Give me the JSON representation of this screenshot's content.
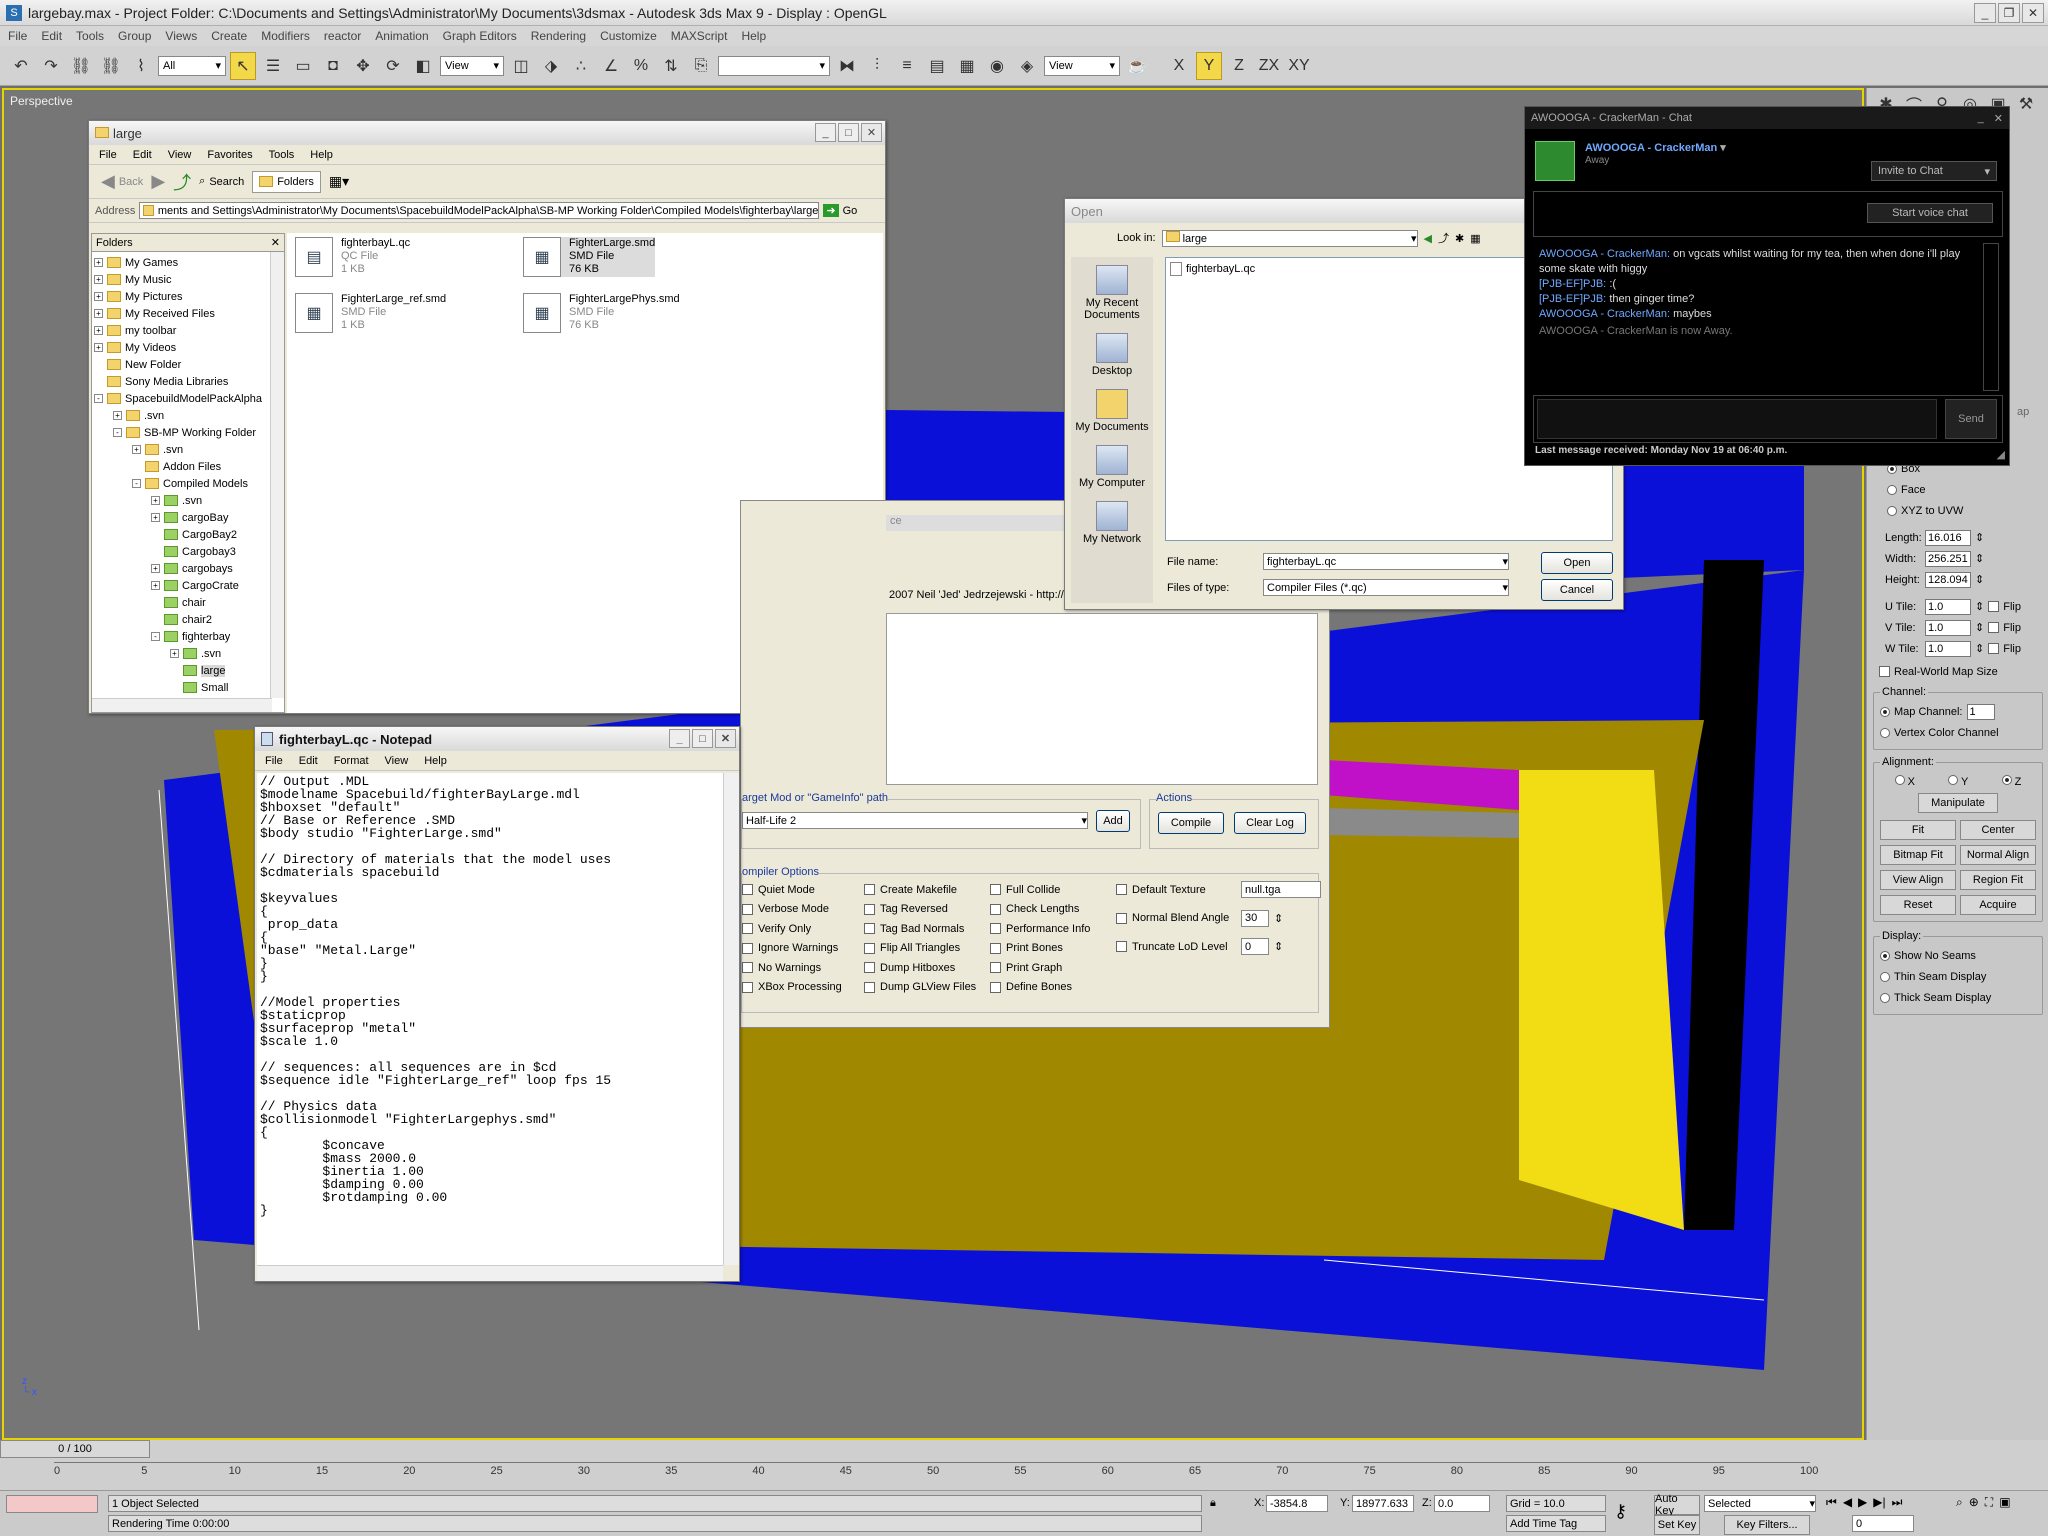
{
  "max": {
    "title": "largebay.max     - Project Folder: C:\\Documents and Settings\\Administrator\\My Documents\\3dsmax     - Autodesk 3ds Max 9     - Display : OpenGL",
    "menu": [
      "File",
      "Edit",
      "Tools",
      "Group",
      "Views",
      "Create",
      "Modifiers",
      "reactor",
      "Animation",
      "Graph Editors",
      "Rendering",
      "Customize",
      "MAXScript",
      "Help"
    ],
    "selection_filter": "All",
    "ref_coord": "View",
    "ref_coord2": "View",
    "axes": [
      "X",
      "Y",
      "Z",
      "ZX",
      "XY"
    ],
    "viewport_label": "Perspective",
    "viewport_colors": {
      "blue": "#0a10d8",
      "olive": "#a08800",
      "yellow": "#f2dc14",
      "magenta": "#c010c8",
      "black": "#000000"
    }
  },
  "uvw": {
    "mapping_options": [
      "Box",
      "Face",
      "XYZ to UVW"
    ],
    "length_label": "Length:",
    "length": "16.016",
    "width_label": "Width:",
    "width": "256.251",
    "height_label": "Height:",
    "height": "128.094",
    "utile_label": "U Tile:",
    "utile": "1.0",
    "vtile_label": "V Tile:",
    "vtile": "1.0",
    "wtile_label": "W Tile:",
    "wtile": "1.0",
    "flip": "Flip",
    "realworld": "Real-World Map Size",
    "channel_title": "Channel:",
    "map_channel": "Map Channel:",
    "map_channel_val": "1",
    "vertex_channel": "Vertex Color Channel",
    "alignment_title": "Alignment:",
    "align_axes": [
      "X",
      "Y",
      "Z"
    ],
    "manipulate": "Manipulate",
    "fit": "Fit",
    "center": "Center",
    "bitmap_fit": "Bitmap Fit",
    "normal_align": "Normal Align",
    "view_align": "View Align",
    "region_fit": "Region Fit",
    "reset": "Reset",
    "acquire": "Acquire",
    "display_title": "Display:",
    "display_opts": [
      "Show No Seams",
      "Thin Seam Display",
      "Thick Seam Display"
    ],
    "map_tab": "ap"
  },
  "timeline": {
    "frame": "0 / 100",
    "ticks": [
      "0",
      "5",
      "10",
      "15",
      "20",
      "25",
      "30",
      "35",
      "40",
      "45",
      "50",
      "55",
      "60",
      "65",
      "70",
      "75",
      "80",
      "85",
      "90",
      "95",
      "100"
    ]
  },
  "status": {
    "objects": "1 Object Selected",
    "render_time": "Rendering Time  0:00:00",
    "x": "-3854.8",
    "y": "18977.633",
    "z": "0.0",
    "grid": "Grid = 10.0",
    "add_time_tag": "Add Time Tag",
    "auto_key": "Auto Key",
    "set_key": "Set Key",
    "selected": "Selected",
    "key_filters": "Key Filters...",
    "frame": "0"
  },
  "explorer": {
    "title": "large",
    "menu": [
      "File",
      "Edit",
      "View",
      "Favorites",
      "Tools",
      "Help"
    ],
    "back": "Back",
    "search": "Search",
    "folders": "Folders",
    "address_label": "Address",
    "address": "ments and Settings\\Administrator\\My Documents\\SpacebuildModelPackAlpha\\SB-MP Working Folder\\Compiled Models\\fighterbay\\large",
    "go": "Go",
    "pane_title": "Folders",
    "tree": [
      {
        "label": "My Games",
        "depth": 0,
        "pm": "+"
      },
      {
        "label": "My Music",
        "depth": 0,
        "pm": "+"
      },
      {
        "label": "My Pictures",
        "depth": 0,
        "pm": "+"
      },
      {
        "label": "My Received Files",
        "depth": 0,
        "pm": "+"
      },
      {
        "label": "my toolbar",
        "depth": 0,
        "pm": "+"
      },
      {
        "label": "My Videos",
        "depth": 0,
        "pm": "+"
      },
      {
        "label": "New Folder",
        "depth": 0,
        "pm": ""
      },
      {
        "label": "Sony Media Libraries",
        "depth": 0,
        "pm": ""
      },
      {
        "label": "SpacebuildModelPackAlpha",
        "depth": 0,
        "pm": "-"
      },
      {
        "label": ".svn",
        "depth": 1,
        "pm": "+"
      },
      {
        "label": "SB-MP Working Folder",
        "depth": 1,
        "pm": "-"
      },
      {
        "label": ".svn",
        "depth": 2,
        "pm": "+"
      },
      {
        "label": "Addon Files",
        "depth": 2,
        "pm": ""
      },
      {
        "label": "Compiled Models",
        "depth": 2,
        "pm": "-"
      },
      {
        "label": ".svn",
        "depth": 3,
        "pm": "+"
      },
      {
        "label": "cargoBay",
        "depth": 3,
        "pm": "+"
      },
      {
        "label": "CargoBay2",
        "depth": 3,
        "pm": ""
      },
      {
        "label": "Cargobay3",
        "depth": 3,
        "pm": ""
      },
      {
        "label": "cargobays",
        "depth": 3,
        "pm": "+"
      },
      {
        "label": "CargoCrate",
        "depth": 3,
        "pm": "+"
      },
      {
        "label": "chair",
        "depth": 3,
        "pm": ""
      },
      {
        "label": "chair2",
        "depth": 3,
        "pm": ""
      },
      {
        "label": "fighterbay",
        "depth": 3,
        "pm": "-"
      },
      {
        "label": ".svn",
        "depth": 4,
        "pm": "+"
      },
      {
        "label": "large",
        "depth": 4,
        "pm": ""
      },
      {
        "label": "Small",
        "depth": 4,
        "pm": ""
      }
    ],
    "files": [
      {
        "name": "fighterbayL.qc",
        "type": "QC File",
        "size": "1 KB"
      },
      {
        "name": "FighterLarge.smd",
        "type": "SMD File",
        "size": "76 KB"
      },
      {
        "name": "FighterLarge_ref.smd",
        "type": "SMD File",
        "size": "1 KB"
      },
      {
        "name": "FighterLargePhys.smd",
        "type": "SMD File",
        "size": "76 KB"
      }
    ]
  },
  "notepad": {
    "title": "fighterbayL.qc - Notepad",
    "menu": [
      "File",
      "Edit",
      "Format",
      "View",
      "Help"
    ],
    "text": "// Output .MDL\n$modelname Spacebuild/fighterBayLarge.mdl\n$hboxset \"default\"\n// Base or Reference .SMD\n$body studio \"FighterLarge.smd\"\n\n// Directory of materials that the model uses\n$cdmaterials spacebuild\n\n$keyvalues\n{\n prop_data\n{\n\"base\" \"Metal.Large\"\n}\n}\n\n//Model properties\n$staticprop\n$surfaceprop \"metal\"\n$scale 1.0\n\n// sequences: all sequences are in $cd\n$sequence idle \"FighterLarge_ref\" loop fps 15\n\n// Physics data\n$collisionmodel \"FighterLargephys.smd\"\n{\n        $concave\n        $mass 2000.0\n        $inertia 1.00\n        $damping 0.00\n        $rotdamping 0.00\n}"
  },
  "compiler": {
    "credit": "2007 Neil 'Jed' Jedrzejewski - http://",
    "target_label": "arget Mod or \"GameInfo\" path",
    "target_value": "Half-Life 2",
    "add": "Add",
    "actions_label": "Actions",
    "compile": "Compile",
    "clear_log": "Clear Log",
    "options_label": "ompiler Options",
    "col1": [
      "Quiet Mode",
      "Verbose Mode",
      "Verify Only",
      "Ignore Warnings",
      "No Warnings",
      "XBox Processing"
    ],
    "col2": [
      "Create Makefile",
      "Tag Reversed",
      "Tag Bad Normals",
      "Flip All Triangles",
      "Dump Hitboxes",
      "Dump GLView Files"
    ],
    "col3": [
      "Full Collide",
      "Check Lengths",
      "Performance Info",
      "Print Bones",
      "Print Graph",
      "Define Bones"
    ],
    "default_texture": "Default Texture",
    "default_texture_val": "null.tga",
    "normal_blend": "Normal Blend Angle",
    "normal_blend_val": "30",
    "truncate_lod": "Truncate LoD Level",
    "truncate_lod_val": "0",
    "partial_label": "ce"
  },
  "open": {
    "title": "Open",
    "look_in_label": "Look in:",
    "look_in": "large",
    "places": [
      "My Recent Documents",
      "Desktop",
      "My Documents",
      "My Computer",
      "My Network"
    ],
    "file": "fighterbayL.qc",
    "filename_label": "File name:",
    "filename": "fighterbayL.qc",
    "filetype_label": "Files of type:",
    "filetype": "Compiler Files (*.qc)",
    "open_btn": "Open",
    "cancel_btn": "Cancel"
  },
  "chat": {
    "title": "AWOOOGA - CrackerMan - Chat",
    "name": "AWOOOGA - CrackerMan",
    "status": "Away",
    "invite": "Invite to Chat",
    "voice": "Start voice chat",
    "messages": [
      {
        "who": "AWOOOGA - CrackerMan:",
        "text": "on vgcats whilst waiting for my tea, then when done i'll play some skate with higgy"
      },
      {
        "who": "[PJB-EF]PJB:",
        "text": ":("
      },
      {
        "who": "[PJB-EF]PJB:",
        "text": "then ginger time?"
      },
      {
        "who": "AWOOOGA - CrackerMan:",
        "text": "maybes"
      }
    ],
    "system": "AWOOOGA - CrackerMan is now Away.",
    "send": "Send",
    "footer": "Last message received: Monday Nov 19 at 06:40 p.m."
  }
}
